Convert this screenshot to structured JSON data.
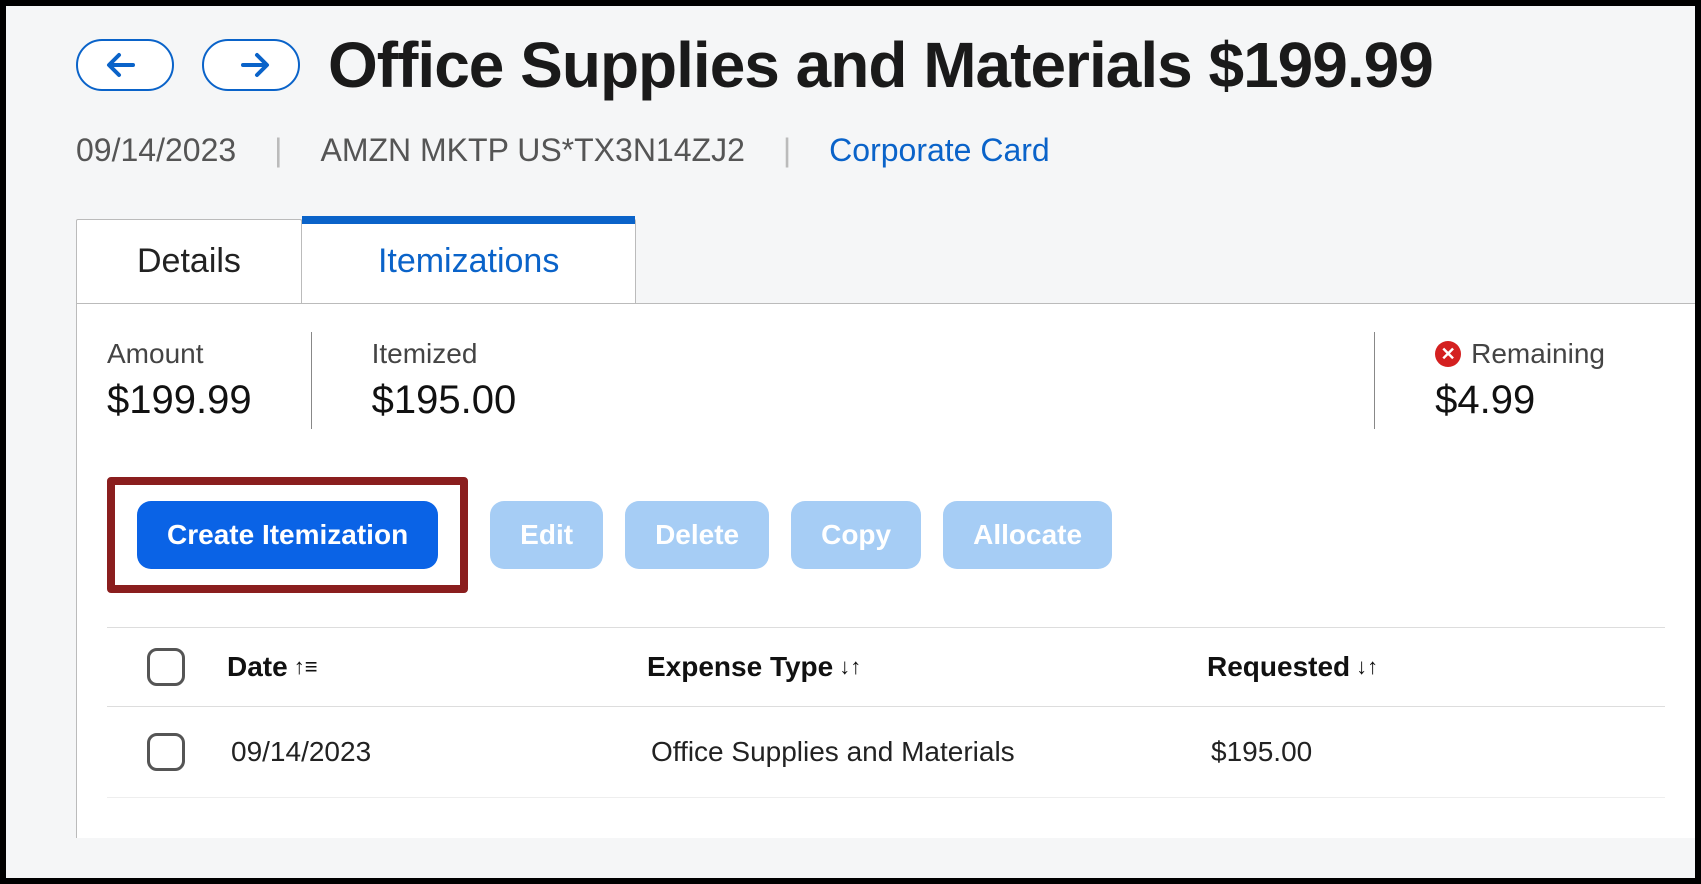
{
  "header": {
    "title": "Office Supplies and Materials $199.99"
  },
  "meta": {
    "date": "09/14/2023",
    "merchant": "AMZN MKTP US*TX3N14ZJ2",
    "payment": "Corporate Card"
  },
  "tabs": {
    "details": "Details",
    "itemizations": "Itemizations"
  },
  "summary": {
    "amount_label": "Amount",
    "amount_value": "$199.99",
    "itemized_label": "Itemized",
    "itemized_value": "$195.00",
    "remaining_label": "Remaining",
    "remaining_value": "$4.99"
  },
  "toolbar": {
    "create": "Create Itemization",
    "edit": "Edit",
    "delete": "Delete",
    "copy": "Copy",
    "allocate": "Allocate"
  },
  "table": {
    "headers": {
      "date": "Date",
      "expense_type": "Expense Type",
      "requested": "Requested"
    },
    "rows": [
      {
        "date": "09/14/2023",
        "expense_type": "Office Supplies and Materials",
        "requested": "$195.00"
      }
    ]
  }
}
